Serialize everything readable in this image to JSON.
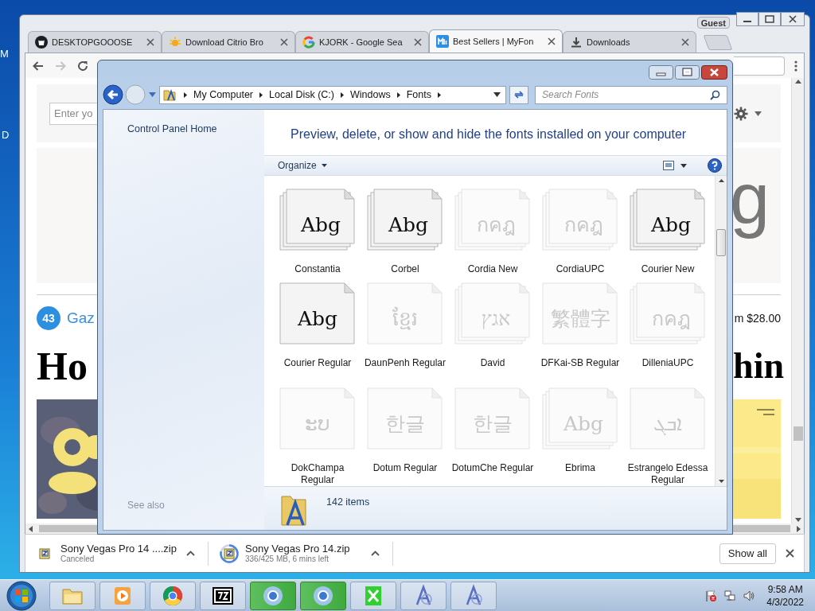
{
  "desktop": {
    "labels": [
      "M",
      "D"
    ]
  },
  "browser": {
    "tabs": [
      {
        "kind": "github",
        "title": "DESKTOPGOOOSE",
        "selected": false
      },
      {
        "kind": "citrio",
        "title": "Download Citrio Bro",
        "selected": false
      },
      {
        "kind": "google",
        "title": "KJORK - Google Sea",
        "selected": false
      },
      {
        "kind": "myfonts",
        "title": "Best Sellers | MyFon",
        "selected": true
      },
      {
        "kind": "download",
        "title": "Downloads",
        "selected": false
      }
    ],
    "profile": "Guest",
    "page": {
      "search_placeholder": "Enter yo",
      "big_letter": "g",
      "rank": "43",
      "link": "Gaz",
      "price": "m $28.00",
      "heading_left": "Ho",
      "heading_right": "hin"
    },
    "downloads": [
      {
        "kind": "canceled",
        "name": "Sony Vegas Pro 14 ....zip",
        "status": "Canceled"
      },
      {
        "kind": "in_progress",
        "name": "Sony Vegas Pro 14.zip",
        "status": "336/425 MB, 6 mins left"
      }
    ],
    "show_all": "Show all"
  },
  "explorer": {
    "breadcrumb": [
      "My Computer",
      "Local Disk (C:)",
      "Windows",
      "Fonts"
    ],
    "search_placeholder": "Search Fonts",
    "sidebar": {
      "home": "Control Panel Home",
      "see_also": "See also"
    },
    "heading": "Preview, delete, or show and hide the fonts installed on your computer",
    "organize": "Organize",
    "fonts": [
      {
        "name": "Constantia",
        "preview": "Abg",
        "stacked": true,
        "hidden": false
      },
      {
        "name": "Corbel",
        "preview": "Abg",
        "stacked": true,
        "hidden": false
      },
      {
        "name": "Cordia New",
        "preview": "กคฎ",
        "stacked": true,
        "hidden": true
      },
      {
        "name": "CordiaUPC",
        "preview": "กคฎ",
        "stacked": true,
        "hidden": true
      },
      {
        "name": "Courier New",
        "preview": "Abg",
        "stacked": true,
        "hidden": false
      },
      {
        "name": "Courier Regular",
        "preview": "Abg",
        "stacked": false,
        "hidden": false
      },
      {
        "name": "DaunPenh Regular",
        "preview": "ខ្មែរ",
        "stacked": false,
        "hidden": true
      },
      {
        "name": "David",
        "preview": "אגץ",
        "stacked": true,
        "hidden": true
      },
      {
        "name": "DFKai-SB Regular",
        "preview": "繁體字",
        "stacked": false,
        "hidden": true
      },
      {
        "name": "DilleniaUPC",
        "preview": "กคฎ",
        "stacked": true,
        "hidden": true
      },
      {
        "name": "DokChampa Regular",
        "preview": "ະບ",
        "stacked": false,
        "hidden": true
      },
      {
        "name": "Dotum Regular",
        "preview": "한글",
        "stacked": false,
        "hidden": true
      },
      {
        "name": "DotumChe Regular",
        "preview": "한글",
        "stacked": false,
        "hidden": true
      },
      {
        "name": "Ebrima",
        "preview": "Abg",
        "stacked": true,
        "hidden": true
      },
      {
        "name": "Estrangelo Edessa Regular",
        "preview": "ܐܒܓ",
        "stacked": false,
        "hidden": true
      }
    ],
    "item_count": "142 items"
  },
  "taskbar": {
    "apps": [
      {
        "kind": "folder",
        "highlighted": false
      },
      {
        "kind": "media",
        "highlighted": false
      },
      {
        "kind": "chrome",
        "highlighted": false
      },
      {
        "kind": "sevenzip",
        "highlighted": false
      },
      {
        "kind": "chrome",
        "highlighted": true
      },
      {
        "kind": "chrome",
        "highlighted": true
      },
      {
        "kind": "xmark",
        "highlighted": false
      },
      {
        "kind": "fontviewer",
        "highlighted": false
      },
      {
        "kind": "fontviewer",
        "highlighted": false
      }
    ],
    "clock": {
      "time": "9:58 AM",
      "date": "4/3/2022"
    }
  }
}
